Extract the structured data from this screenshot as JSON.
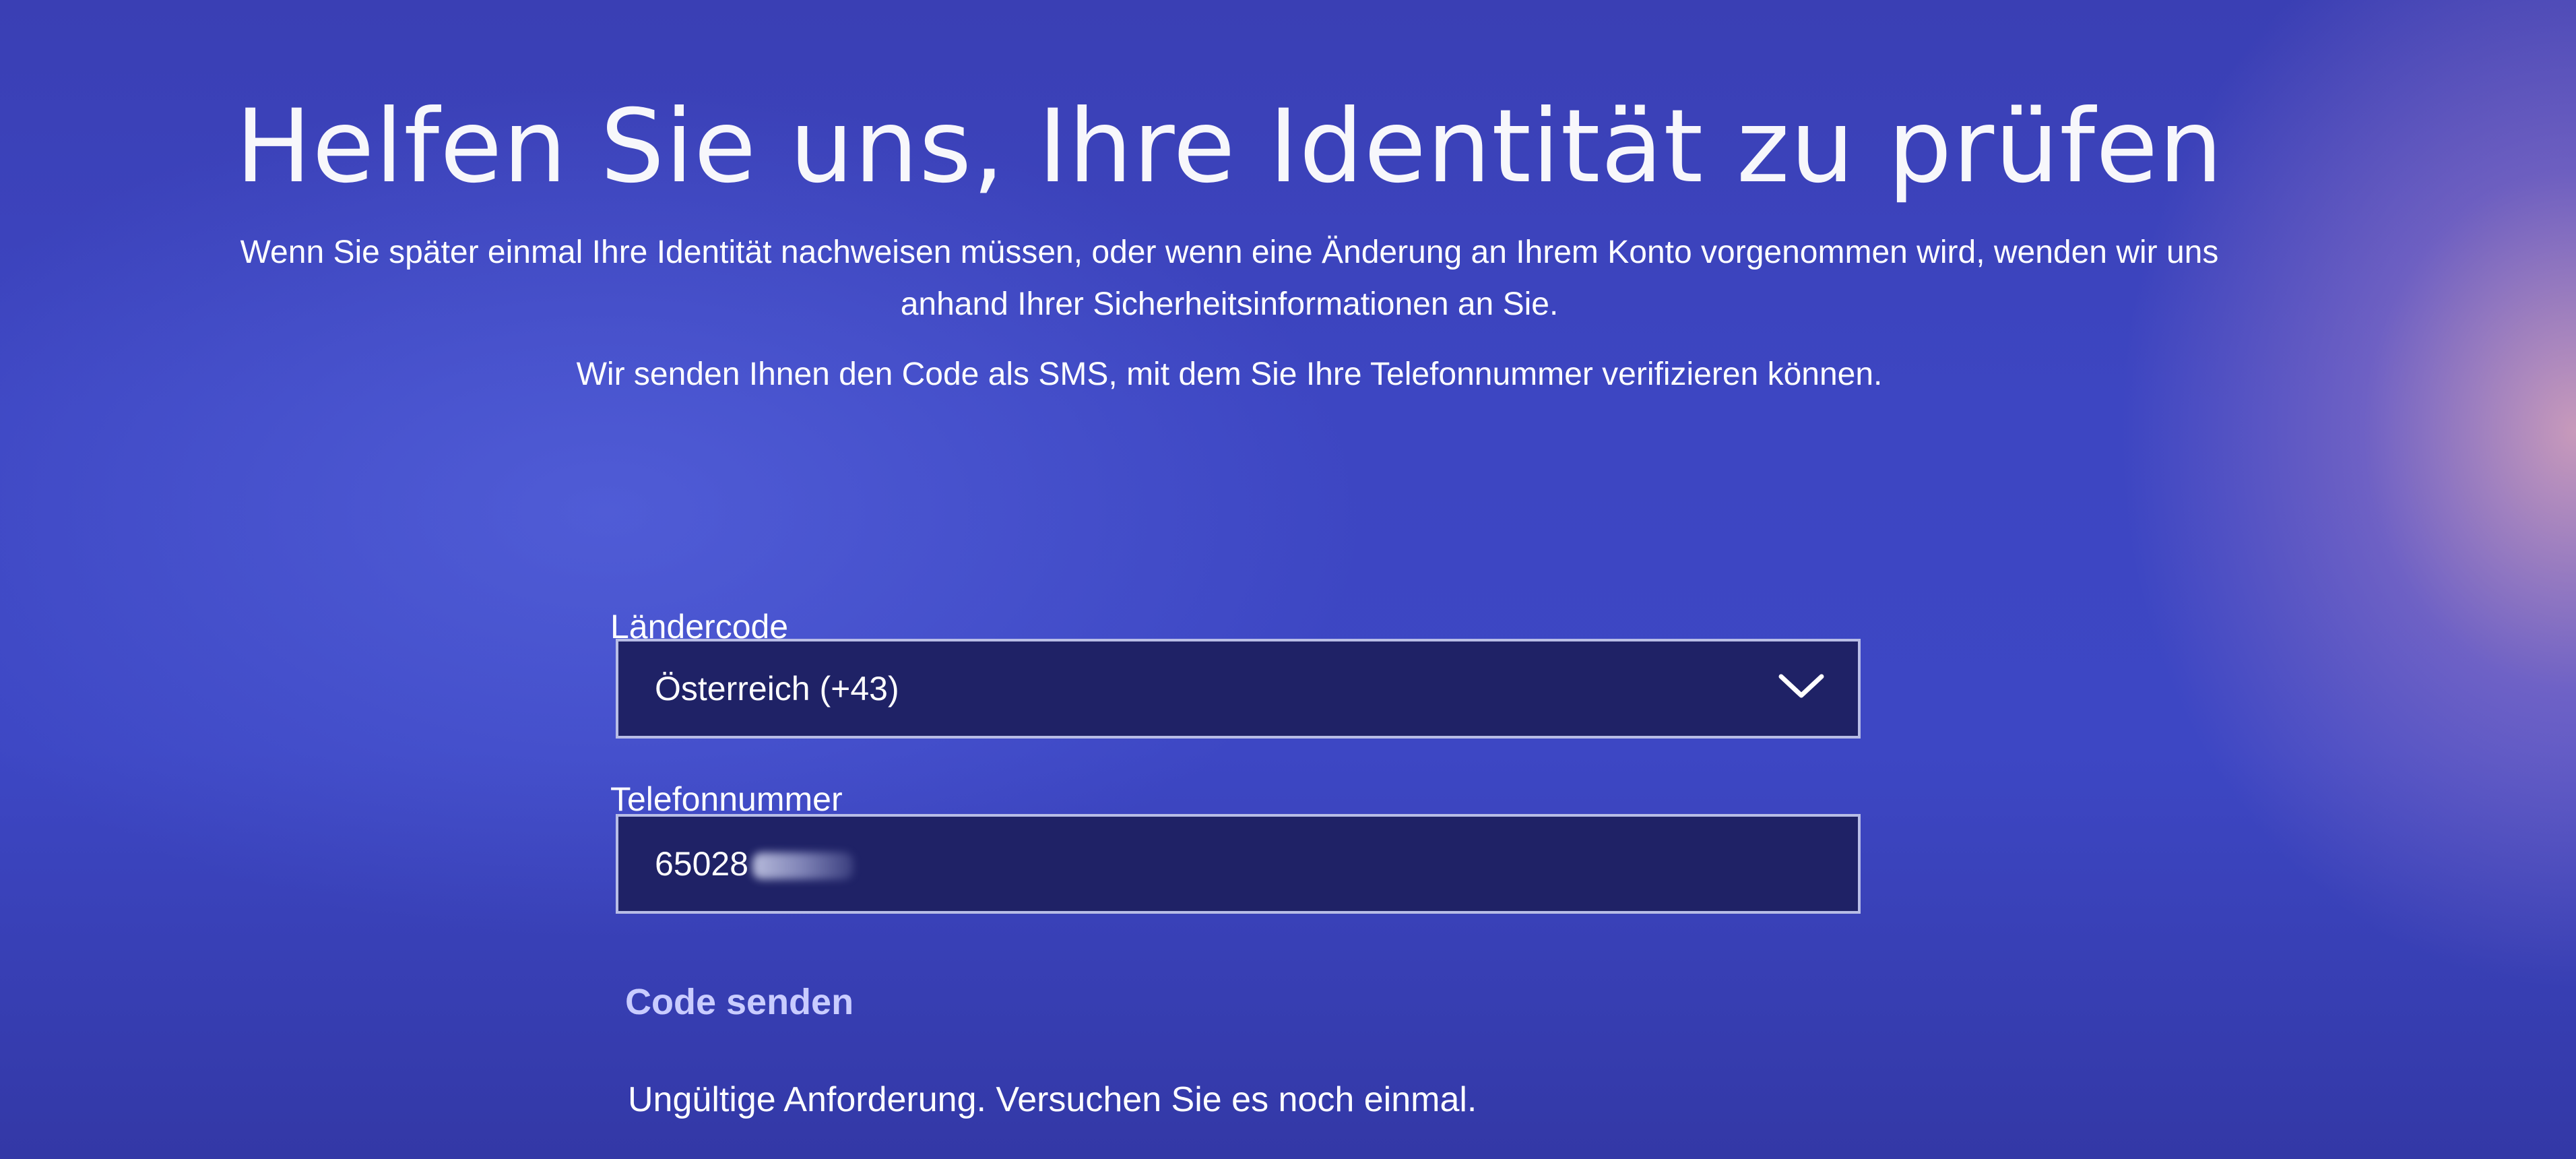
{
  "header": {
    "title": "Helfen Sie uns, Ihre Identität zu prüfen",
    "description_line1": "Wenn Sie später einmal Ihre Identität nachweisen müssen, oder wenn eine Änderung an Ihrem Konto vorgenommen wird, wenden wir uns",
    "description_line2": "anhand Ihrer Sicherheitsinformationen an Sie.",
    "sms_info": "Wir senden Ihnen den Code als SMS, mit dem Sie Ihre Telefonnummer verifizieren können."
  },
  "form": {
    "country_code": {
      "label": "Ländercode",
      "selected": "Österreich (+43)",
      "icon": "chevron-down-icon"
    },
    "phone": {
      "label": "Telefonnummer",
      "value_visible": "65028"
    },
    "send_code_label": "Code senden",
    "error_message": "Ungültige Anforderung. Versuchen Sie es noch einmal."
  },
  "colors": {
    "background": "#3d46c2",
    "field_background": "#1f2266",
    "field_border": "#b8bde6",
    "link": "#c9ccff",
    "text": "#ffffff"
  }
}
